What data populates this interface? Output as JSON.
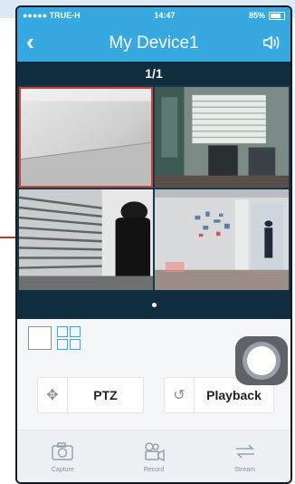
{
  "status_bar": {
    "carrier": "●●●●● TRUE-H",
    "time": "14:47",
    "battery": "85%"
  },
  "header": {
    "title": "My Device1"
  },
  "page_indicator": "1/1",
  "cameras": [
    {
      "label": "camera-1"
    },
    {
      "label": "camera-2"
    },
    {
      "label": "camera-3"
    },
    {
      "label": "camera-4"
    }
  ],
  "controls": {
    "ptz_label": "PTZ",
    "playback_label": "Playback"
  },
  "tabs": [
    {
      "label": "Capture",
      "icon": "camera-icon"
    },
    {
      "label": "Record",
      "icon": "video-camera-icon"
    },
    {
      "label": "Stream",
      "icon": "swap-arrows-icon"
    }
  ],
  "colors": {
    "accent": "#36a9e1",
    "dark_bar": "#0f2d3e",
    "selection": "#d0413a"
  }
}
